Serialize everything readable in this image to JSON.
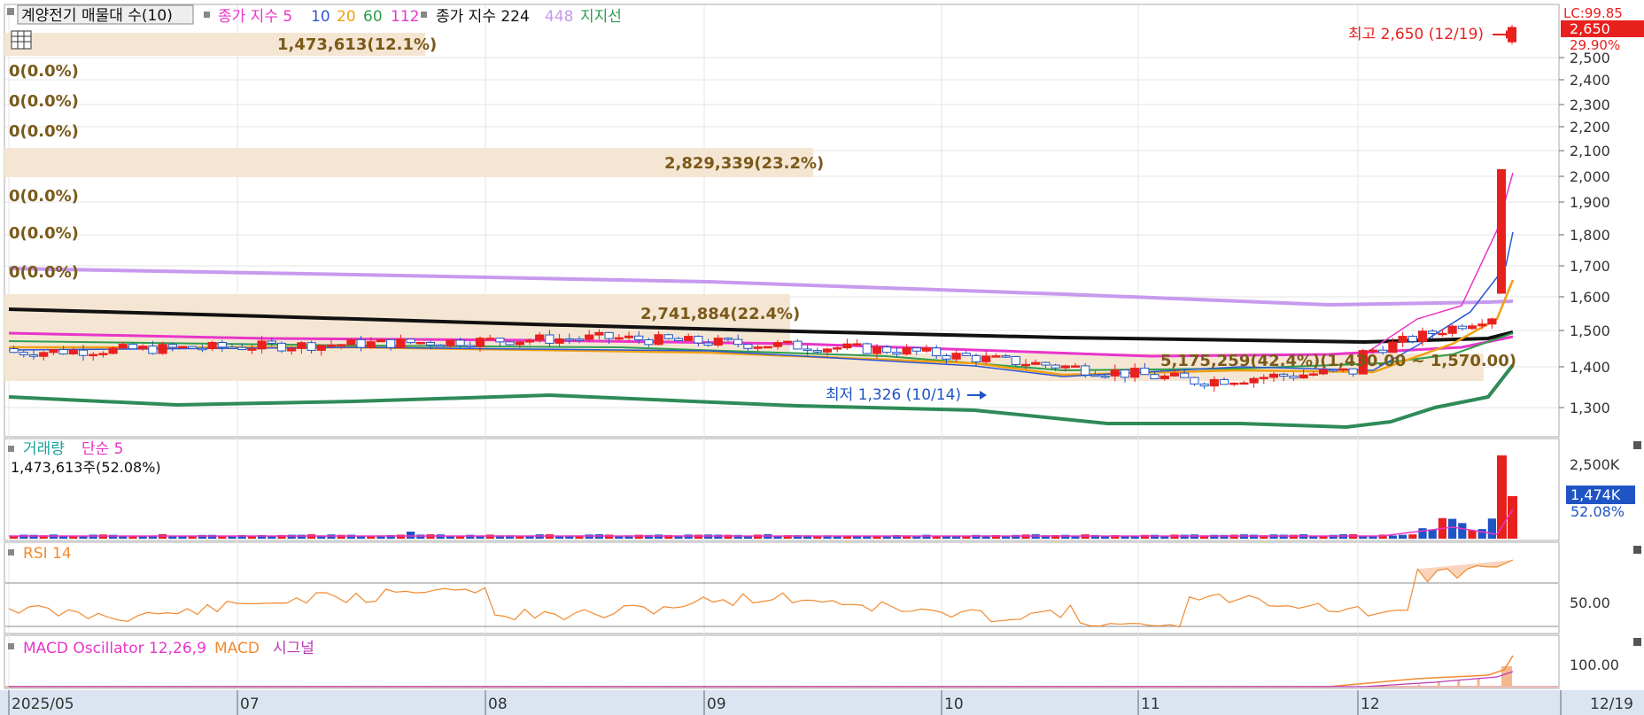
{
  "legend": {
    "stock_title": "계양전기 매물대 수(10)",
    "ma_label": "종가 지수 5",
    "ma_10": "10",
    "ma_20": "20",
    "ma_60": "60",
    "ma_112": "112",
    "ma2_label": "종가 지수 224",
    "ma_448": "448",
    "support": "지지선"
  },
  "colors": {
    "up": "#e8201e",
    "down": "#1f54c4",
    "ma5": "#e835c9",
    "ma10": "#2f56d8",
    "ma20": "#f0a012",
    "ma60": "#2e9d4e",
    "ma112": "#e835c9",
    "ma224": "#111111",
    "ma448": "#c79aee",
    "support": "#2e8b57",
    "profile": "#f5e6d3",
    "profile_text": "#7a5a1a",
    "volume_ma": "#e835c9",
    "rsi": "#f28a30",
    "macd_osc": "#f6b890",
    "macd": "#f28a30",
    "signal": "#b83ab8",
    "axis_bg": "#dbe5f1",
    "price_box": "#e8201e",
    "volume_box": "#1f54c4"
  },
  "price_axis": {
    "ticks": [
      "2,500",
      "2,400",
      "2,300",
      "2,200",
      "2,100",
      "2,000",
      "1,900",
      "1,800",
      "1,700",
      "1,600",
      "1,500",
      "1,400",
      "1,300"
    ],
    "lc_label": "LC:99.85",
    "current_price": "2,650",
    "change_pct": "29.90%"
  },
  "volume_profile": [
    {
      "label": "1,473,613(12.1%)"
    },
    {
      "label": "0(0.0%)"
    },
    {
      "label": "0(0.0%)"
    },
    {
      "label": "0(0.0%)"
    },
    {
      "label": "2,829,339(23.2%)"
    },
    {
      "label": "0(0.0%)"
    },
    {
      "label": "0(0.0%)"
    },
    {
      "label": "0(0.0%)"
    },
    {
      "label": "2,741,884(22.4%)"
    },
    {
      "label": "5,175,259(42.4%)(1,430.00 ~ 1,570.00)"
    }
  ],
  "annotations": {
    "high": "최고 2,650 (12/19)",
    "low": "최저 1,326 (10/14)"
  },
  "volume_panel": {
    "title": "거래량",
    "ma_label": "단순 5",
    "summary": "1,473,613주(52.08%)",
    "axis_tick": "2,500K",
    "current": "1,474K",
    "current_pct": "52.08%"
  },
  "rsi_panel": {
    "title": "RSI 14",
    "axis_tick": "50.00"
  },
  "macd_panel": {
    "title": "MACD Oscillator 12,26,9",
    "macd_label": "MACD",
    "signal_label": "시그널",
    "axis_tick": "100.00"
  },
  "x_axis": {
    "ticks": [
      "2025/05",
      "07",
      "08",
      "09",
      "10",
      "11",
      "12"
    ],
    "last_date": "12/19"
  },
  "chart_data": {
    "type": "candlestick",
    "price_ylim": [
      1200,
      2650
    ],
    "monthly_closes": [
      {
        "month": "2025/05",
        "close": 1440
      },
      {
        "month": "07",
        "close": 1460
      },
      {
        "month": "08",
        "close": 1480
      },
      {
        "month": "09",
        "close": 1445
      },
      {
        "month": "10",
        "close": 1365
      },
      {
        "month": "11",
        "close": 1410
      },
      {
        "month": "12",
        "close": 2650
      }
    ],
    "extremes": {
      "high": 2650,
      "high_date": "12/19",
      "low": 1326,
      "low_date": "10/14"
    },
    "volume_profile_zone": {
      "from": 1430,
      "to": 1570,
      "volume": 5175259,
      "pct": 42.4
    }
  }
}
